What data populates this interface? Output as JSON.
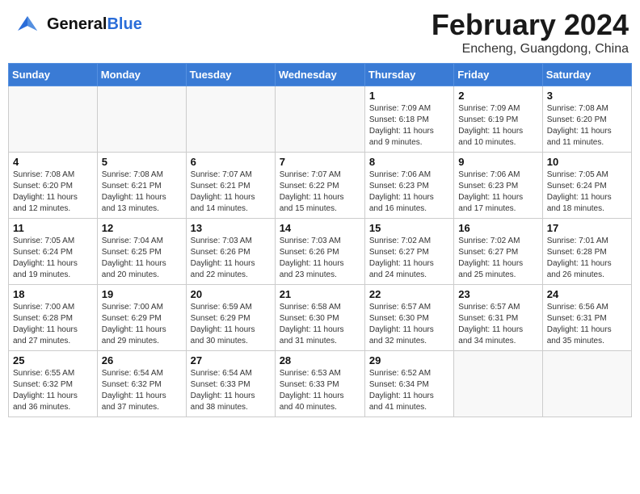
{
  "header": {
    "logo_general": "General",
    "logo_blue": "Blue",
    "month_year": "February 2024",
    "location": "Encheng, Guangdong, China"
  },
  "days_of_week": [
    "Sunday",
    "Monday",
    "Tuesday",
    "Wednesday",
    "Thursday",
    "Friday",
    "Saturday"
  ],
  "weeks": [
    [
      {
        "day": "",
        "info": ""
      },
      {
        "day": "",
        "info": ""
      },
      {
        "day": "",
        "info": ""
      },
      {
        "day": "",
        "info": ""
      },
      {
        "day": "1",
        "info": "Sunrise: 7:09 AM\nSunset: 6:18 PM\nDaylight: 11 hours\nand 9 minutes."
      },
      {
        "day": "2",
        "info": "Sunrise: 7:09 AM\nSunset: 6:19 PM\nDaylight: 11 hours\nand 10 minutes."
      },
      {
        "day": "3",
        "info": "Sunrise: 7:08 AM\nSunset: 6:20 PM\nDaylight: 11 hours\nand 11 minutes."
      }
    ],
    [
      {
        "day": "4",
        "info": "Sunrise: 7:08 AM\nSunset: 6:20 PM\nDaylight: 11 hours\nand 12 minutes."
      },
      {
        "day": "5",
        "info": "Sunrise: 7:08 AM\nSunset: 6:21 PM\nDaylight: 11 hours\nand 13 minutes."
      },
      {
        "day": "6",
        "info": "Sunrise: 7:07 AM\nSunset: 6:21 PM\nDaylight: 11 hours\nand 14 minutes."
      },
      {
        "day": "7",
        "info": "Sunrise: 7:07 AM\nSunset: 6:22 PM\nDaylight: 11 hours\nand 15 minutes."
      },
      {
        "day": "8",
        "info": "Sunrise: 7:06 AM\nSunset: 6:23 PM\nDaylight: 11 hours\nand 16 minutes."
      },
      {
        "day": "9",
        "info": "Sunrise: 7:06 AM\nSunset: 6:23 PM\nDaylight: 11 hours\nand 17 minutes."
      },
      {
        "day": "10",
        "info": "Sunrise: 7:05 AM\nSunset: 6:24 PM\nDaylight: 11 hours\nand 18 minutes."
      }
    ],
    [
      {
        "day": "11",
        "info": "Sunrise: 7:05 AM\nSunset: 6:24 PM\nDaylight: 11 hours\nand 19 minutes."
      },
      {
        "day": "12",
        "info": "Sunrise: 7:04 AM\nSunset: 6:25 PM\nDaylight: 11 hours\nand 20 minutes."
      },
      {
        "day": "13",
        "info": "Sunrise: 7:03 AM\nSunset: 6:26 PM\nDaylight: 11 hours\nand 22 minutes."
      },
      {
        "day": "14",
        "info": "Sunrise: 7:03 AM\nSunset: 6:26 PM\nDaylight: 11 hours\nand 23 minutes."
      },
      {
        "day": "15",
        "info": "Sunrise: 7:02 AM\nSunset: 6:27 PM\nDaylight: 11 hours\nand 24 minutes."
      },
      {
        "day": "16",
        "info": "Sunrise: 7:02 AM\nSunset: 6:27 PM\nDaylight: 11 hours\nand 25 minutes."
      },
      {
        "day": "17",
        "info": "Sunrise: 7:01 AM\nSunset: 6:28 PM\nDaylight: 11 hours\nand 26 minutes."
      }
    ],
    [
      {
        "day": "18",
        "info": "Sunrise: 7:00 AM\nSunset: 6:28 PM\nDaylight: 11 hours\nand 27 minutes."
      },
      {
        "day": "19",
        "info": "Sunrise: 7:00 AM\nSunset: 6:29 PM\nDaylight: 11 hours\nand 29 minutes."
      },
      {
        "day": "20",
        "info": "Sunrise: 6:59 AM\nSunset: 6:29 PM\nDaylight: 11 hours\nand 30 minutes."
      },
      {
        "day": "21",
        "info": "Sunrise: 6:58 AM\nSunset: 6:30 PM\nDaylight: 11 hours\nand 31 minutes."
      },
      {
        "day": "22",
        "info": "Sunrise: 6:57 AM\nSunset: 6:30 PM\nDaylight: 11 hours\nand 32 minutes."
      },
      {
        "day": "23",
        "info": "Sunrise: 6:57 AM\nSunset: 6:31 PM\nDaylight: 11 hours\nand 34 minutes."
      },
      {
        "day": "24",
        "info": "Sunrise: 6:56 AM\nSunset: 6:31 PM\nDaylight: 11 hours\nand 35 minutes."
      }
    ],
    [
      {
        "day": "25",
        "info": "Sunrise: 6:55 AM\nSunset: 6:32 PM\nDaylight: 11 hours\nand 36 minutes."
      },
      {
        "day": "26",
        "info": "Sunrise: 6:54 AM\nSunset: 6:32 PM\nDaylight: 11 hours\nand 37 minutes."
      },
      {
        "day": "27",
        "info": "Sunrise: 6:54 AM\nSunset: 6:33 PM\nDaylight: 11 hours\nand 38 minutes."
      },
      {
        "day": "28",
        "info": "Sunrise: 6:53 AM\nSunset: 6:33 PM\nDaylight: 11 hours\nand 40 minutes."
      },
      {
        "day": "29",
        "info": "Sunrise: 6:52 AM\nSunset: 6:34 PM\nDaylight: 11 hours\nand 41 minutes."
      },
      {
        "day": "",
        "info": ""
      },
      {
        "day": "",
        "info": ""
      }
    ]
  ]
}
